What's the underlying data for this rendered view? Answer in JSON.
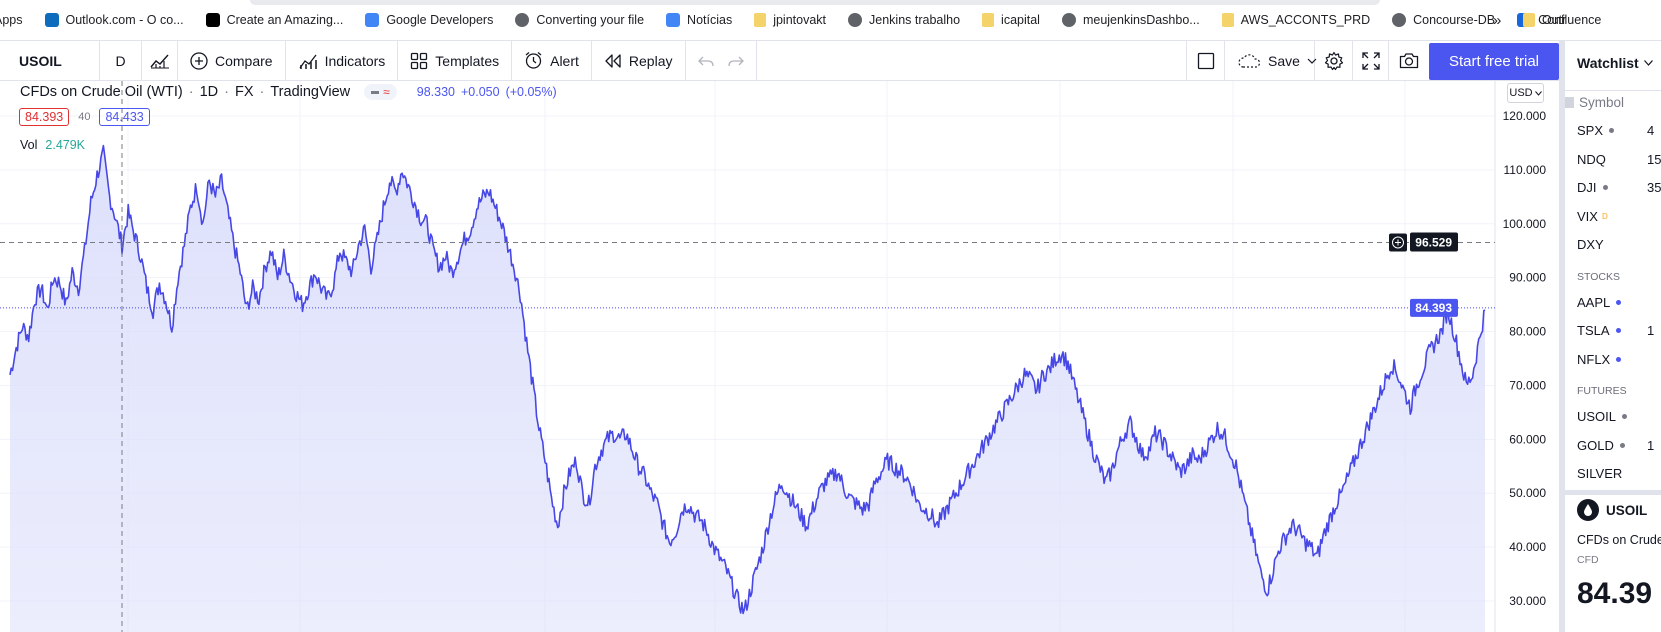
{
  "bookmarks": {
    "items": [
      {
        "label": "Apps",
        "icon": "apps-icon",
        "color": "#5f6368"
      },
      {
        "label": "Outlook.com - O co...",
        "icon": "outlook-icon",
        "color": "#0f6cbd"
      },
      {
        "label": "Create an Amazing...",
        "icon": "wix-icon",
        "color": "#000000"
      },
      {
        "label": "Google Developers",
        "icon": "google-dev-icon",
        "color": "#4285f4"
      },
      {
        "label": "Converting your file",
        "icon": "globe-icon",
        "color": "#5f6368"
      },
      {
        "label": "Notícias",
        "icon": "news-icon",
        "color": "#4285f4"
      },
      {
        "label": "jpintovakt",
        "icon": "folder-icon",
        "color": "#f4d36b"
      },
      {
        "label": "Jenkins trabalho",
        "icon": "globe-icon",
        "color": "#5f6368"
      },
      {
        "label": "icapital",
        "icon": "folder-icon",
        "color": "#f4d36b"
      },
      {
        "label": "meujenkinsDashbo...",
        "icon": "globe-icon",
        "color": "#5f6368"
      },
      {
        "label": "AWS_ACCONTS_PRD",
        "icon": "folder-icon",
        "color": "#f4d36b"
      },
      {
        "label": "Concourse-DB",
        "icon": "globe-icon",
        "color": "#5f6368"
      },
      {
        "label": "Confluence",
        "icon": "confluence-icon",
        "color": "#1868db"
      }
    ],
    "overflow": "»",
    "other_label": "Outr"
  },
  "toolbar": {
    "symbol": "USOIL",
    "interval": "D",
    "compare": "Compare",
    "indicators": "Indicators",
    "templates": "Templates",
    "alert": "Alert",
    "replay": "Replay",
    "save": "Save",
    "start_trial": "Start free trial"
  },
  "legend": {
    "title": "CFDs on Crude Oil (WTI)",
    "interval": "1D",
    "exchange": "FX",
    "source": "TradingView",
    "last_price": "98.330",
    "change": "+0.050",
    "change_pct": "(+0.05%)",
    "bid": "84.393",
    "spread": "40",
    "ask": "84.433",
    "vol_label": "Vol",
    "vol_value": "2.479K",
    "currency": "USD"
  },
  "colors": {
    "accent": "#4b55f0",
    "line": "#4747e6",
    "fill": "#dcdffb",
    "bid": "#e03131",
    "vol": "#26a69a"
  },
  "chart_data": {
    "type": "area",
    "title": "",
    "xlabel": "",
    "ylabel": "",
    "ylim": [
      30,
      125
    ],
    "yticks": [
      "120.000",
      "110.000",
      "100.000",
      "90.000",
      "80.000",
      "70.000",
      "60.000",
      "50.000",
      "40.000",
      "30.000"
    ],
    "crosshair_price": "96.529",
    "last_price_label": "84.393",
    "series": [
      {
        "values": [
          72,
          77,
          81,
          79,
          86,
          88,
          84,
          90,
          89,
          85,
          91,
          88,
          95,
          104,
          109,
          113,
          105,
          101,
          96,
          102,
          98,
          94,
          88,
          84,
          89,
          86,
          81,
          90,
          96,
          103,
          107,
          100,
          108,
          105,
          108,
          102,
          96,
          91,
          84,
          88,
          86,
          92,
          95,
          90,
          94,
          90,
          87,
          85,
          88,
          91,
          88,
          86,
          89,
          95,
          93,
          91,
          96,
          99,
          92,
          97,
          103,
          108,
          106,
          110,
          107,
          104,
          101,
          100,
          95,
          92,
          94,
          91,
          94,
          97,
          99,
          103,
          105,
          106,
          103,
          100,
          96,
          92,
          87,
          78,
          70,
          62,
          56,
          49,
          44,
          50,
          54,
          56,
          50,
          48,
          55,
          58,
          60,
          61,
          60,
          61,
          58,
          55,
          53,
          50,
          48,
          44,
          41,
          43,
          47,
          48,
          46,
          45,
          43,
          40,
          38,
          36,
          33,
          30,
          28,
          32,
          36,
          40,
          45,
          49,
          52,
          50,
          48,
          46,
          44,
          47,
          50,
          52,
          53,
          54,
          51,
          49,
          48,
          47,
          48,
          52,
          54,
          56,
          55,
          54,
          53,
          51,
          48,
          47,
          46,
          44,
          46,
          48,
          50,
          52,
          54,
          56,
          58,
          60,
          62,
          64,
          66,
          68,
          70,
          72,
          71,
          69,
          72,
          73,
          75,
          76,
          74,
          70,
          66,
          62,
          58,
          55,
          52,
          54,
          58,
          61,
          63,
          60,
          57,
          58,
          61,
          60,
          58,
          56,
          54,
          55,
          57,
          56,
          58,
          60,
          62,
          61,
          58,
          55,
          50,
          45,
          40,
          35,
          32,
          36,
          40,
          42,
          44,
          43,
          41,
          40,
          38,
          42,
          45,
          48,
          50,
          53,
          56,
          59,
          62,
          65,
          68,
          71,
          74,
          72,
          69,
          66,
          70,
          73,
          76,
          78,
          80,
          84,
          80,
          75,
          70,
          72,
          78,
          84
        ]
      }
    ]
  },
  "watchlist": {
    "header": "Watchlist",
    "symbol_col": "Symbol",
    "rows": [
      {
        "symbol": "SPX",
        "value": "4",
        "dot": "#787b86"
      },
      {
        "symbol": "NDQ",
        "value": "15",
        "dot": ""
      },
      {
        "symbol": "DJI",
        "value": "35",
        "dot": "#787b86"
      },
      {
        "symbol": "VIX",
        "value": "",
        "dot": "",
        "sup": "D"
      },
      {
        "symbol": "DXY",
        "value": "",
        "dot": ""
      }
    ],
    "stocks_label": "STOCKS",
    "stocks": [
      {
        "symbol": "AAPL",
        "value": "",
        "dot": "#4b55f0"
      },
      {
        "symbol": "TSLA",
        "value": "1",
        "dot": "#4b55f0"
      },
      {
        "symbol": "NFLX",
        "value": "",
        "dot": "#4b55f0"
      }
    ],
    "futures_label": "FUTURES",
    "futures": [
      {
        "symbol": "USOIL",
        "value": "",
        "dot": "#787b86"
      },
      {
        "symbol": "GOLD",
        "value": "1",
        "dot": "#787b86"
      },
      {
        "symbol": "SILVER",
        "value": "",
        "dot": ""
      }
    ],
    "detail": {
      "symbol": "USOIL",
      "name": "CFDs on Crude",
      "type": "CFD",
      "price": "84.39"
    }
  }
}
